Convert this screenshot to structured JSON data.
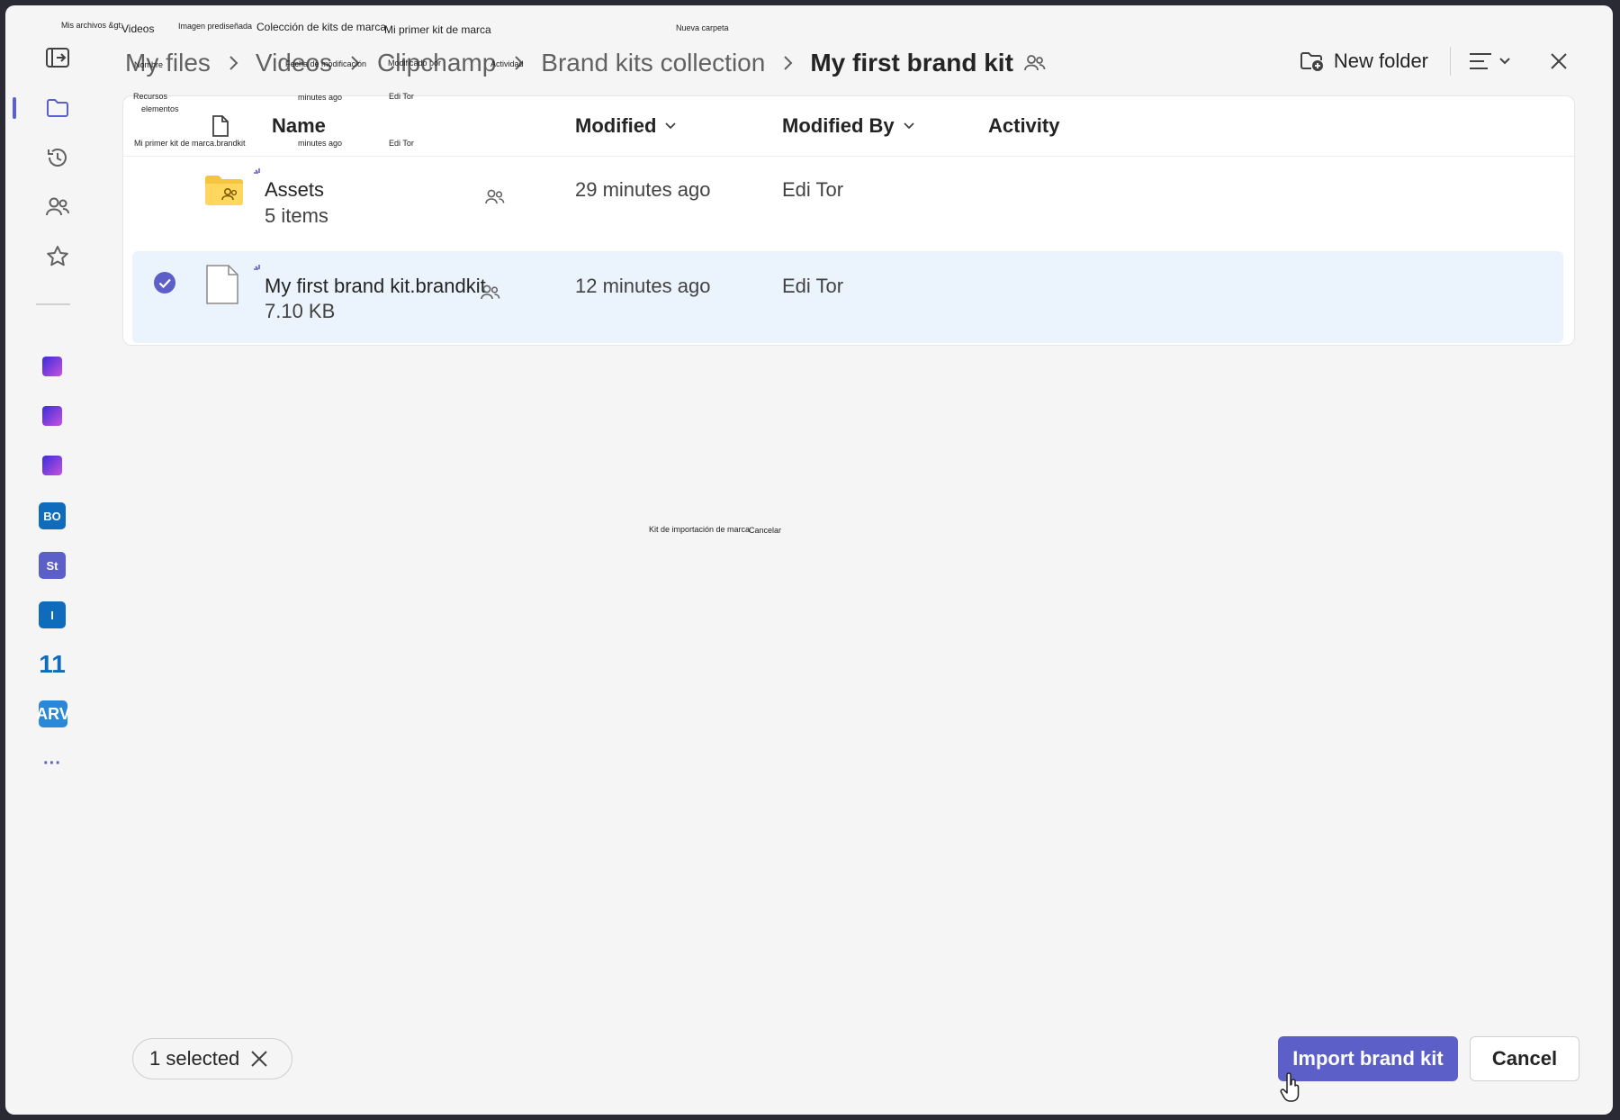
{
  "overlay_labels": {
    "my_files": "Mis archivos &gt;",
    "videos": "Videos",
    "stock": "Imagen prediseñada",
    "collection": "Colección de kits de marca",
    "my_kit": "Mi primer kit de marca",
    "new_folder": "Nueva carpeta",
    "name": "Nombre",
    "modified": "Fecha de modificación",
    "modified_by": "Modificado por",
    "activity": "Actividad",
    "assets": "Recursos",
    "items": "elementos",
    "minutes_ago_1": "minutes ago",
    "edi_1": "Edi Tor",
    "kit_file": "Mi primer kit de marca.brandkit",
    "minutes_ago_2": "minutes ago",
    "edi_2": "Edi Tor",
    "import": "Kit de importación de marca",
    "cancel": "Cancelar"
  },
  "breadcrumb": {
    "items": [
      "My files",
      "Videos",
      "Clipchamp",
      "Brand kits collection"
    ],
    "current": "My first brand kit"
  },
  "toolbar": {
    "new_folder": "New folder"
  },
  "columns": {
    "name": "Name",
    "modified": "Modified",
    "modified_by": "Modified By",
    "activity": "Activity"
  },
  "rows": [
    {
      "name": "Assets",
      "sub": "5 items",
      "modified": "29 minutes ago",
      "modified_by": "Edi Tor",
      "type": "shared-folder",
      "selected": false
    },
    {
      "name": "My first brand kit.brandkit",
      "sub": "7.10 KB",
      "modified": "12 minutes ago",
      "modified_by": "Edi Tor",
      "type": "file",
      "selected": true
    }
  ],
  "rail": {
    "apps": [
      "BO",
      "St",
      "I",
      "11",
      "ARV"
    ],
    "more": "···"
  },
  "footer": {
    "selected": "1 selected",
    "import_button": "Import brand kit",
    "cancel_button": "Cancel"
  },
  "colors": {
    "accent": "#5b5fc7",
    "selected_row": "#ebf3fc",
    "folder": "#f5c63d"
  }
}
